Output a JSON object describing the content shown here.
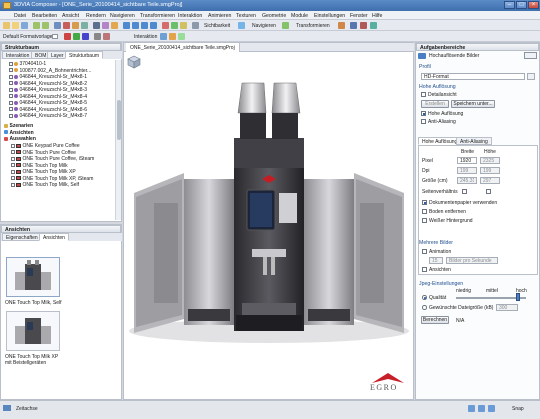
{
  "window": {
    "title": "3DVIA Composer - [ONE_Serie_20100414_sichtbare Teile.smgProj]"
  },
  "menu": [
    "Datei",
    "Bearbeiten",
    "Ansicht",
    "Rendern",
    "Navigieren",
    "Transformieren",
    "Interaktion",
    "Animieren",
    "Texturen",
    "Geometrie",
    "Module",
    "Einstellungen",
    "Fenster",
    "Hilfe"
  ],
  "toolbar": {
    "format_label": "Default Formatvorlage",
    "sichtbarkeit": "Sichtbarkeit",
    "navigieren": "Navigieren",
    "transformieren": "Transformieren",
    "interaktion": "Interaktion"
  },
  "left_panel": {
    "title": "Strukturbaum",
    "tabs": [
      "Interaktion",
      "BOM",
      "Layer",
      "Strukturbaum"
    ],
    "tree": [
      "37040410-1",
      "100877.002_A_Bohnentrichter...",
      "046844_Kreuzschl-Sr_M4x8-1",
      "046844_Kreuzschl-Sr_M4x8-2",
      "046844_Kreuzschl-Sr_M4x8-3",
      "046844_Kreuzschl-Sr_M4x8-4",
      "046844_Kreuzschl-Sr_M4x8-5",
      "046844_Kreuzschl-Sr_M4x8-6",
      "046844_Kreuzschl-Sr_M4x8-7"
    ],
    "sections": [
      "Szenarien",
      "Ansichten",
      "Auswahlen"
    ],
    "selections": [
      "ONE Keypad Pure Coffee",
      "ONE Touch Pure Coffee",
      "ONE Touch Pure Coffee, iSteam",
      "ONE Touch Top Milk",
      "ONE Touch Top Milk XP",
      "ONE Touch Top Milk XP, iSteam",
      "ONE Touch Top Milk, Self"
    ]
  },
  "views_panel": {
    "title": "Ansichten",
    "tabs": [
      "Eigenschaften",
      "Ansichten"
    ],
    "thumbs": [
      "ONE Touch Top Milk, Self",
      "ONE Touch Top Milk XP mit Beistellgeräten"
    ]
  },
  "viewport": {
    "tab": "ONE_Serie_20100414_sichtbare Teile.smgProj",
    "logo": "EGRO"
  },
  "right_panel": {
    "title": "Aufgabenbereiche",
    "subtitle": "Hochauflösende Bilder",
    "profil": {
      "header": "Profil",
      "value": "HD-Format"
    },
    "hohe": {
      "header": "Hohe Auflösung",
      "detailansicht": "Detailansicht",
      "erstellen": "Erstellen",
      "speichern": "Speichern unter...",
      "hohe_aufloesung": "Hohe Auflösung",
      "anti_aliasing": "Anti-Aliasing"
    },
    "tabs": [
      "Hohe Auflösung",
      "Anti-Aliasing"
    ],
    "size": {
      "col_breite": "Breite",
      "col_hoehe": "Höhe",
      "pixel_label": "Pixel",
      "pixel_b": "1920",
      "pixel_h": "2325",
      "dpi_label": "Dpi",
      "dpi_b": "199",
      "dpi_h": "199",
      "groesse_label": "Größe (cm)",
      "groesse_b": "245.31",
      "groesse_h": "297"
    },
    "seitenverhaeltnis": "Seitenverhältnis",
    "options": [
      "Dokumentenpapier verwenden",
      "Boden entfernen",
      "Weißer Hintergrund"
    ],
    "mehrere": {
      "header": "Mehrere Bilder",
      "animation": "Animation",
      "count": "15",
      "per": "Bilder pro Sekunde",
      "ansichten": "Ansichten"
    },
    "jpeg": {
      "header": "Jpeg-Einstellungen",
      "niedrig": "niedrig",
      "mittel": "mittel",
      "hoch": "hoch",
      "qualitaet": "Qualität",
      "dateigroesse": "Gewünschte Dateigröße (kB)",
      "kb": "300",
      "berechnen": "Berechnen",
      "na": "N/A"
    }
  },
  "statusbar": {
    "left": "Zeitachse",
    "snap": "Snap"
  }
}
